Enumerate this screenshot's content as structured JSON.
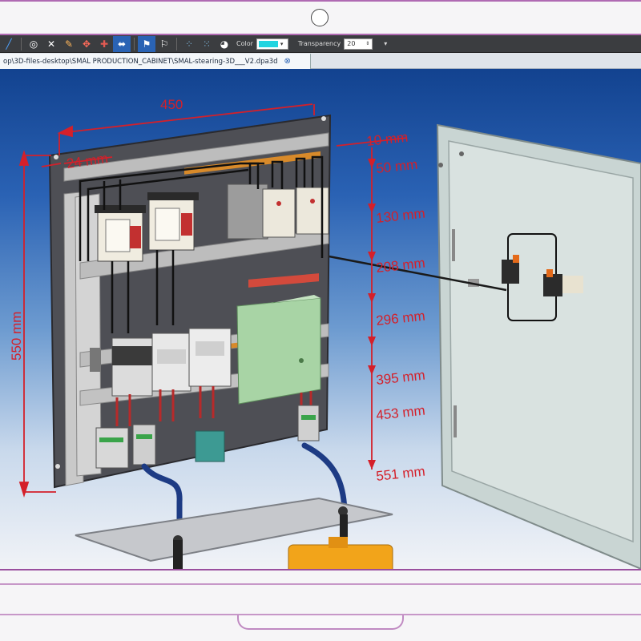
{
  "toolbar": {
    "color_label": "Color",
    "transparency_label": "Transparency",
    "transparency_value": "20",
    "color_value": "#22d4e0"
  },
  "document_tab": {
    "path": "op\\3D-files-desktop\\SMAL PRODUCTION_CABINET\\SMAL-stearing-3D___V2.dpa3d",
    "close_icon": "close-icon"
  },
  "dimensions": {
    "width_label": "450",
    "left_offset": "24 mm",
    "top_offset": "10 mm",
    "height": "550 mm",
    "levels": [
      "50 mm",
      "130 mm",
      "208 mm",
      "296 mm",
      "395 mm",
      "453 mm",
      "551 mm"
    ]
  },
  "view_tools": [
    "rotate-icon",
    "fit-view-icon",
    "select-view-icon",
    "axis-view-icon",
    "cube-front-icon",
    "cube-back-icon",
    "cube-left-icon",
    "cube-right-icon",
    "cube-top-icon",
    "cube-bottom-icon"
  ],
  "colors": {
    "dimension": "#d4202a",
    "accent": "#2a63b4"
  }
}
